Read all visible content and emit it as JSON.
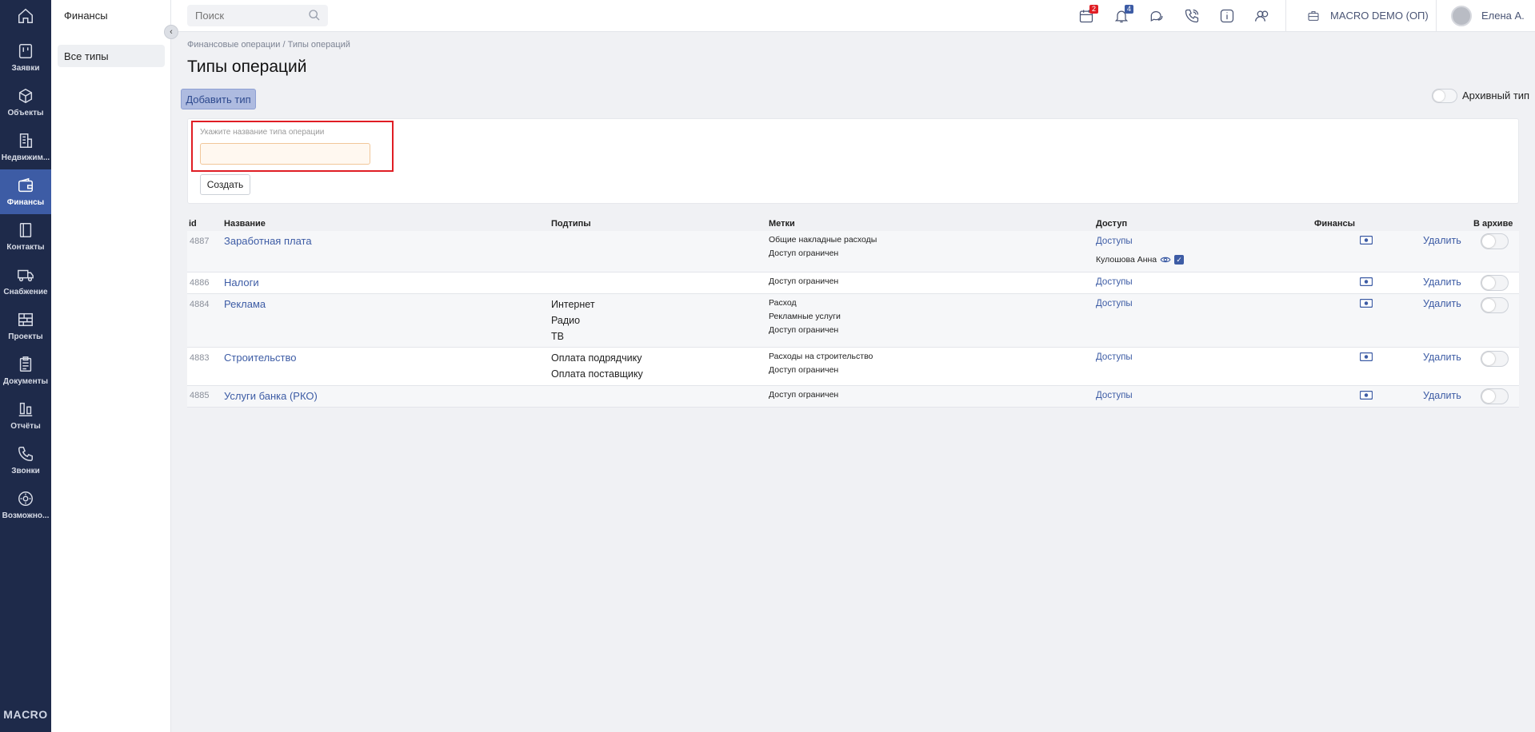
{
  "rail": {
    "items": [
      {
        "label": "Заявки",
        "icon": "kanban-icon"
      },
      {
        "label": "Объекты",
        "icon": "cube-icon"
      },
      {
        "label": "Недвижим...",
        "icon": "building-icon"
      },
      {
        "label": "Финансы",
        "icon": "wallet-icon",
        "active": true
      },
      {
        "label": "Контакты",
        "icon": "contacts-icon"
      },
      {
        "label": "Снабжение",
        "icon": "truck-icon"
      },
      {
        "label": "Проекты",
        "icon": "projects-icon"
      },
      {
        "label": "Документы",
        "icon": "clipboard-icon"
      },
      {
        "label": "Отчёты",
        "icon": "bar-chart-icon"
      },
      {
        "label": "Звонки",
        "icon": "phone-icon"
      },
      {
        "label": "Возможно...",
        "icon": "settings-gear-icon"
      }
    ],
    "brand": "MACRO"
  },
  "subnav": {
    "title": "Финансы",
    "item": "Все типы"
  },
  "topbar": {
    "search_placeholder": "Поиск",
    "calendar_badge": "2",
    "notifications_badge": "4",
    "company": "MACRO DEMO (ОП)",
    "user": "Елена А."
  },
  "breadcrumb": "Финансовые операции  /  Типы операций",
  "page_title": "Типы операций",
  "add_button": "Добавить тип",
  "archive_label": "Архивный тип",
  "create_form": {
    "label": "Укажите название типа операции",
    "value": "",
    "button": "Создать"
  },
  "table": {
    "headers": {
      "id": "id",
      "name": "Название",
      "subtypes": "Подтипы",
      "tags": "Метки",
      "access": "Доступ",
      "finance": "Финансы",
      "archive": "В архиве"
    },
    "rows": [
      {
        "id": "4887",
        "name": "Заработная плата",
        "subtypes": [],
        "tags": [
          "Общие накладные расходы",
          "Доступ ограничен"
        ],
        "access": "Доступы",
        "access_user": "Кулошова Анна",
        "delete": "Удалить"
      },
      {
        "id": "4886",
        "name": "Налоги",
        "subtypes": [],
        "tags": [
          "Доступ ограничен"
        ],
        "access": "Доступы",
        "delete": "Удалить"
      },
      {
        "id": "4884",
        "name": "Реклама",
        "subtypes": [
          "Интернет",
          "Радио",
          "ТВ"
        ],
        "tags": [
          "Расход",
          "Рекламные услуги",
          "Доступ ограничен"
        ],
        "access": "Доступы",
        "delete": "Удалить"
      },
      {
        "id": "4883",
        "name": "Строительство",
        "subtypes": [
          "Оплата подрядчику",
          "Оплата поставщику"
        ],
        "tags": [
          "Расходы на строительство",
          "Доступ ограничен"
        ],
        "access": "Доступы",
        "delete": "Удалить"
      },
      {
        "id": "4885",
        "name": "Услуги банка (РКО)",
        "subtypes": [],
        "tags": [
          "Доступ ограничен"
        ],
        "access": "Доступы",
        "delete": "Удалить"
      }
    ]
  },
  "colors": {
    "rail": "#1e2a4a",
    "accent": "#3d5ca5",
    "highlight_frame": "#e01d24",
    "badge_red": "#e01d24",
    "badge_blue": "#3d5ca5"
  }
}
